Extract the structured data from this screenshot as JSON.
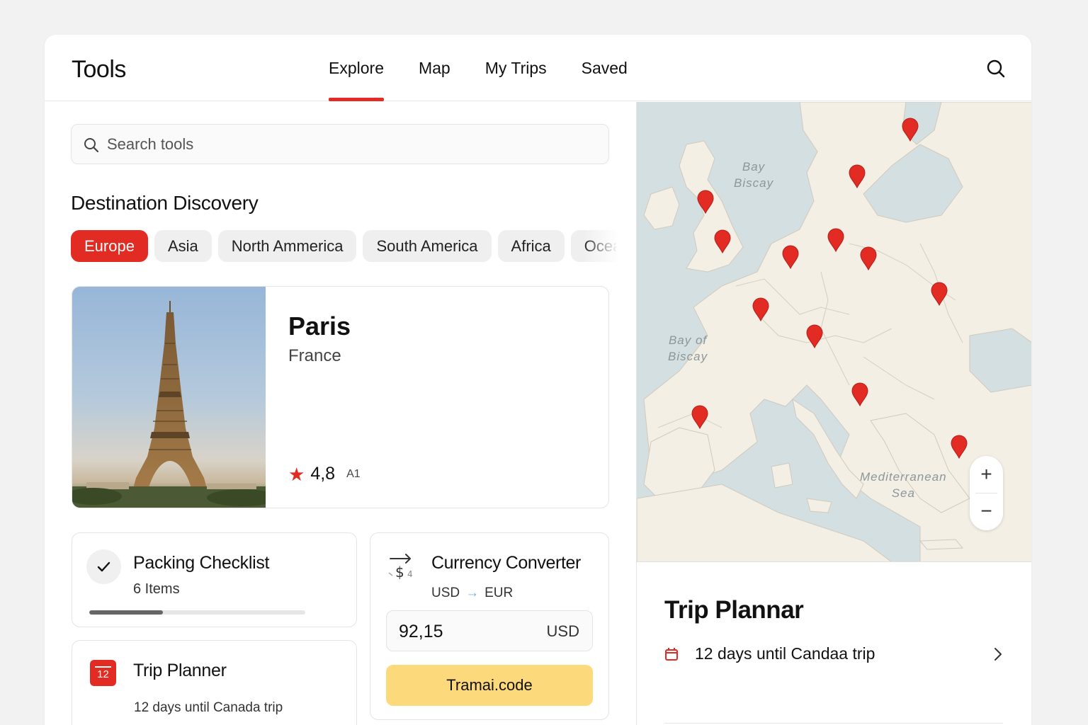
{
  "app": {
    "title": "Tools"
  },
  "nav": {
    "items": [
      "Explore",
      "Map",
      "My Trips",
      "Saved"
    ],
    "active": "Explore"
  },
  "search": {
    "placeholder": "Search tools"
  },
  "discovery": {
    "title": "Destination Discovery",
    "regions": [
      "Europe",
      "Asia",
      "North Ammerica",
      "South America",
      "Africa",
      "Oceania"
    ],
    "active_region": "Europe"
  },
  "destination": {
    "name": "Paris",
    "country": "France",
    "rating": "4,8",
    "rating_count": "A1"
  },
  "packing": {
    "title": "Packing Checklist",
    "subtitle": "6 Items",
    "progress": 0.34
  },
  "planner_card": {
    "title": "Trip Planner",
    "subtitle": "12 days until Canada trip",
    "calendar_day": "12"
  },
  "currency": {
    "title": "Currency Converter",
    "from": "USD",
    "to": "EUR",
    "amount": "92,15",
    "amount_unit": "USD",
    "button_label": "Tramai.code"
  },
  "map": {
    "labels": {
      "bay_top": "Bay\nBiscay",
      "bay_left": "Bay of\nBiscay",
      "sea": "Mediterranean\nSea"
    },
    "zoom_in": "+",
    "zoom_out": "−",
    "pin_icon": "map-pin-icon"
  },
  "trip_panel": {
    "title": "Trip Plannar",
    "item": "12 days until Candaa trip"
  },
  "colors": {
    "accent": "#e12b23",
    "button_yellow": "#fcd97a",
    "sea": "#d3dfe1",
    "land": "#f3efe5"
  }
}
